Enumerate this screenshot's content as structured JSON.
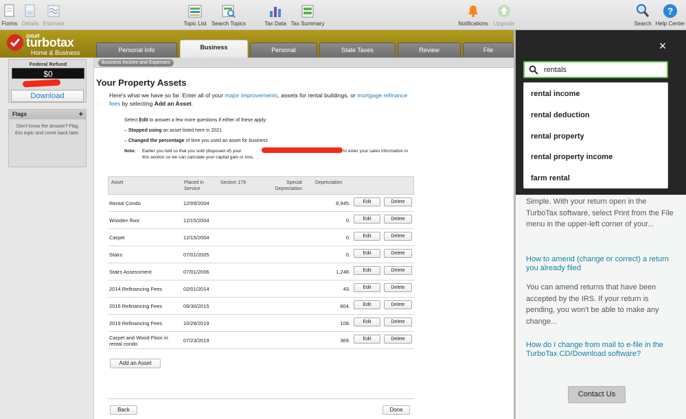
{
  "toolbar": {
    "left": [
      {
        "label": "Forms"
      },
      {
        "label": "Details"
      },
      {
        "label": "Estimate"
      }
    ],
    "center": [
      {
        "label": "Topic List"
      },
      {
        "label": "Search Topics"
      },
      {
        "label": "Tax Data"
      },
      {
        "label": "Tax Summary"
      }
    ],
    "right": [
      {
        "label": "Notifications"
      },
      {
        "label": "Upgrade"
      },
      {
        "label": "Search"
      },
      {
        "label": "Help Center"
      }
    ]
  },
  "brand": {
    "intuit": "intuit",
    "product": "turbotax",
    "edition": "Home & Business"
  },
  "tabs": [
    "Personal Info",
    "Business",
    "Personal",
    "State Taxes",
    "Review",
    "File"
  ],
  "active_tab": "Business",
  "sidebar": {
    "refund_label": "Federal Refund",
    "refund_amount": "$0",
    "download_label": "Download",
    "flags_title": "Flags",
    "flags_plus": "+",
    "flags_text": "Don't know the answer? Flag this topic and come back later."
  },
  "breadcrumb": "Business Income and Expenses",
  "page": {
    "title": "Your Property Assets",
    "intro_1": "Here's what we have so far. Enter all of your ",
    "intro_link_1": "major improvements",
    "intro_2": ", assets for rental buildings, or ",
    "intro_link_2": "mortgage refinance fees",
    "intro_3": " by selecting ",
    "intro_bold": "Add an Asset",
    "intro_4": ".",
    "select_line_1": "Select ",
    "select_bold": "Edit",
    "select_line_2": " to answer a few more questions if either of these apply:",
    "bullet_1_bold": "Stopped using",
    "bullet_1_rest": " an asset listed here in 2021",
    "bullet_2_bold": "Changed the percentage",
    "bullet_2_rest": " of time you used an asset for business",
    "bullet_dash": "–",
    "note_label": "Note:",
    "note_text_1": "Earlier you told us that you sold (disposed of) your",
    "note_text_2": "Be sure to enter your sales information in this section so we can calculate your capital gain or loss."
  },
  "table": {
    "headers": {
      "asset": "Asset",
      "placed_1": "Placed in",
      "placed_2": "Service",
      "section179": "Section 179",
      "special_1": "Special",
      "special_2": "Depreciation",
      "depreciation": "Depreciation"
    },
    "edit_label": "Edit",
    "delete_label": "Delete",
    "rows": [
      {
        "asset": "Rental Condo",
        "asset2": "",
        "date": "12/09/2004",
        "dep": "8,945."
      },
      {
        "asset": "Wooden floor",
        "asset2": "",
        "date": "12/15/2004",
        "dep": "0."
      },
      {
        "asset": "Carpet",
        "asset2": "",
        "date": "12/15/2004",
        "dep": "0."
      },
      {
        "asset": "Stairs",
        "asset2": "",
        "date": "07/01/2005",
        "dep": "0."
      },
      {
        "asset": "Stairs Assessment",
        "asset2": "",
        "date": "07/01/2006",
        "dep": "1,248."
      },
      {
        "asset": "2014 Refinancing Fees",
        "asset2": "",
        "date": "02/01/2014",
        "dep": "43."
      },
      {
        "asset": "2015 Refinancing Fees",
        "asset2": "",
        "date": "09/30/2015",
        "dep": "604."
      },
      {
        "asset": "2019 Refinancing Fees",
        "asset2": "",
        "date": "10/28/2019",
        "dep": "108."
      },
      {
        "asset": "Carpet and Wood Floor in",
        "asset2": "rental condo",
        "date": "07/23/2019",
        "dep": "369."
      }
    ]
  },
  "actions": {
    "add_asset": "Add an Asset",
    "back": "Back",
    "done": "Done"
  },
  "search_panel": {
    "close": "×",
    "query": "rentals",
    "suggestions": [
      "rental income",
      "rental deduction",
      "rental property",
      "rental property income",
      "farm rental"
    ],
    "result_text_1": "Simple. With your return open in the TurboTax software, select Print from the File menu in the upper-left corner of your...",
    "result_link_1": "How to amend (change or correct) a return you already filed",
    "result_text_2": "You can amend returns that have been accepted by the IRS. If your return is pending, you won't be able to make any change...",
    "result_link_2": "How do I change from mail to e-file in the TurboTax CD/Download software?",
    "contact": "Contact Us"
  },
  "colors": {
    "brand_gold": "#a38d17",
    "link_blue": "#1a7bc5",
    "search_green": "#5fba4e",
    "panel_dark": "#262626",
    "panel_link": "#0d84a3"
  }
}
